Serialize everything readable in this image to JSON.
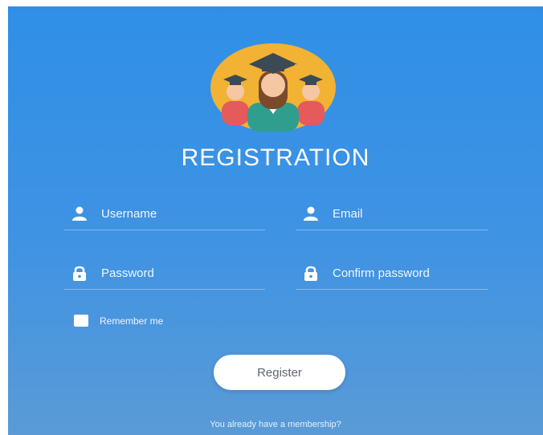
{
  "form": {
    "title": "REGISTRATION",
    "username_placeholder": "Username",
    "email_placeholder": "Email",
    "password_placeholder": "Password",
    "confirm_password_placeholder": "Confirm password",
    "remember_label": "Remember me",
    "register_label": "Register",
    "footer_text": "You already have a membership?"
  },
  "icons": {
    "avatar": "graduates-avatar-icon",
    "username": "user-icon",
    "email": "user-icon",
    "password": "lock-icon",
    "confirm_password": "lock-icon"
  },
  "colors": {
    "background_top": "#2f8fe6",
    "background_bottom": "#5a9bd6",
    "avatar_circle": "#f2b233",
    "button_bg": "#ffffff"
  }
}
